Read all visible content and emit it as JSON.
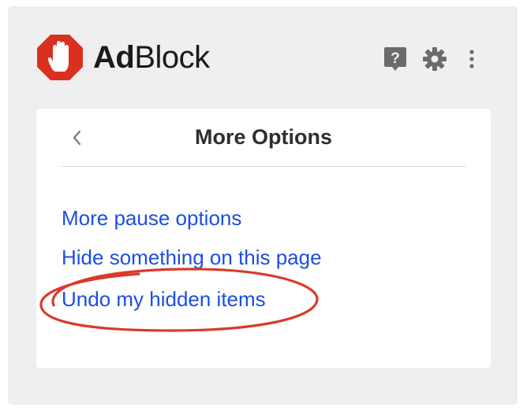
{
  "header": {
    "brand_part1": "Ad",
    "brand_part2": "Block",
    "logo_icon": "stop-hand-icon",
    "actions": [
      "help-icon",
      "gear-icon",
      "kebab-menu-icon"
    ]
  },
  "panel": {
    "title": "More Options",
    "back_icon": "chevron-left-icon",
    "options": [
      "More pause options",
      "Hide something on this page",
      "Undo my hidden items"
    ]
  },
  "colors": {
    "logo_red": "#d9301f",
    "link_blue": "#1d4ee0",
    "annotation_red": "#d93a2b",
    "icon_gray": "#6b6b6b"
  }
}
